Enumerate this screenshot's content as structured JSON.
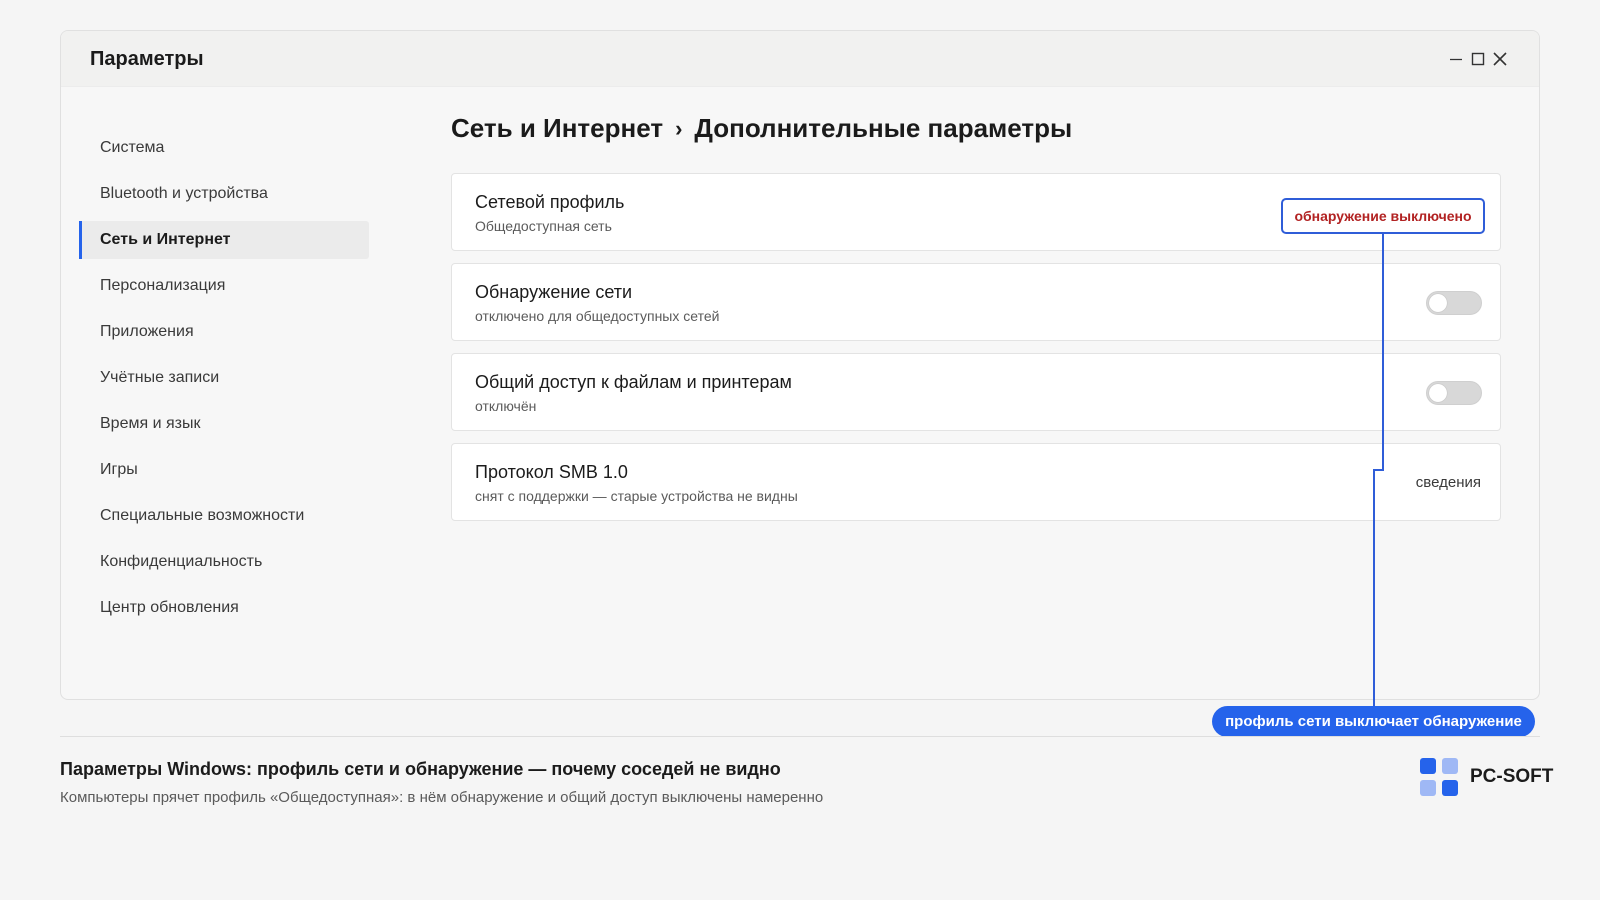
{
  "window": {
    "title": "Параметры",
    "controls": [
      "minimize-icon",
      "maximize-icon",
      "close-icon"
    ]
  },
  "sidebar": {
    "items": [
      {
        "label": "Система",
        "active": false
      },
      {
        "label": "Bluetooth и устройства",
        "active": false
      },
      {
        "label": "Сеть и Интернет",
        "active": true
      },
      {
        "label": "Персонализация",
        "active": false
      },
      {
        "label": "Приложения",
        "active": false
      },
      {
        "label": "Учётные записи",
        "active": false
      },
      {
        "label": "Время и язык",
        "active": false
      },
      {
        "label": "Игры",
        "active": false
      },
      {
        "label": "Специальные возможности",
        "active": false
      },
      {
        "label": "Конфиденциальность",
        "active": false
      },
      {
        "label": "Центр обновления",
        "active": false
      }
    ]
  },
  "breadcrumb": {
    "parent": "Сеть и Интернет",
    "separator": "›",
    "current": "Дополнительные параметры"
  },
  "cards": [
    {
      "title": "Сетевой профиль",
      "subtitle": "Общедоступная сеть"
    },
    {
      "title": "Обнаружение сети",
      "subtitle": "отключено для общедоступных сетей",
      "toggle": false
    },
    {
      "title": "Общий доступ к файлам и принтерам",
      "subtitle": "отключён",
      "toggle": false
    },
    {
      "title": "Протокол SMB 1.0",
      "subtitle": "снят с поддержки — старые устройства не видны",
      "action": "сведения"
    }
  ],
  "annotations": {
    "badge": "обнаружение выключено",
    "pill": "профиль сети выключает обнаружение"
  },
  "footer": {
    "title": "Параметры Windows: профиль сети и обнаружение — почему соседей не видно",
    "subtitle": "Компьютеры прячет профиль «Общедоступная»: в нём обнаружение и общий доступ выключены намеренно"
  },
  "brand": {
    "name": "PC-SOFT"
  },
  "colors": {
    "accent": "#2563eb",
    "badge_text": "#b22222",
    "badge_border": "#2f5dd8",
    "background": "#f5f5f5"
  }
}
